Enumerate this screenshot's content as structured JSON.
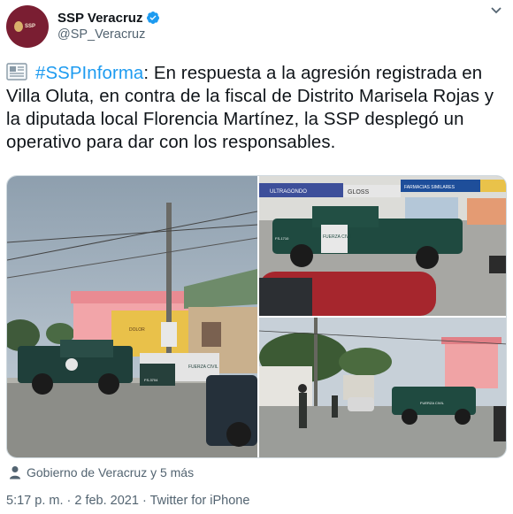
{
  "account": {
    "display_name": "SSP Veracruz",
    "handle": "@SP_Veracruz",
    "avatar_text": "SSP"
  },
  "tweet": {
    "hashtag": "#SSPInforma",
    "text": ": En respuesta a la agresión registrada en Villa Oluta, en contra de la fiscal de Distrito Marisela Rojas y la diputada local Florencia Martínez, la SSP desplegó un operativo para dar con los responsables."
  },
  "photos": {
    "left_labels": [
      "FUERZA CIVIL",
      "DOLOR",
      "FS-3704"
    ],
    "top_right_labels": [
      "ULTRAGONDO",
      "GLOSS",
      "FARMACIAS SIMILARES",
      "FUERZA CIVIL",
      "FS-1710"
    ],
    "bottom_right_labels": [
      "FUERZA CIVIL"
    ]
  },
  "tagged": {
    "text": "Gobierno de Veracruz y 5 más"
  },
  "meta": {
    "time": "5:17 p. m.",
    "separator": " · ",
    "date": "2 feb. 2021",
    "client": "Twitter for iPhone"
  },
  "colors": {
    "accent": "#1d9bf0",
    "brand": "#7a1e32",
    "secondary_text": "#536471"
  },
  "icons": [
    "verified-icon",
    "more-icon",
    "newspaper-icon",
    "person-icon"
  ]
}
